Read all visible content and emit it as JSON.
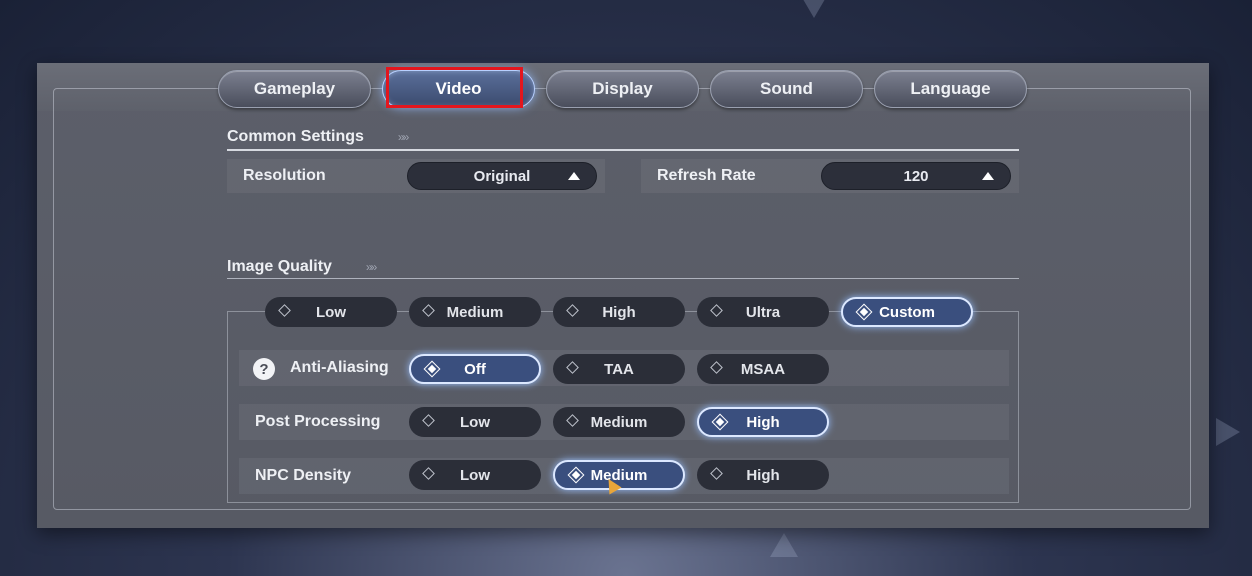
{
  "tabs": [
    {
      "label": "Gameplay",
      "active": false
    },
    {
      "label": "Video",
      "active": true
    },
    {
      "label": "Display",
      "active": false
    },
    {
      "label": "Sound",
      "active": false
    },
    {
      "label": "Language",
      "active": false
    }
  ],
  "common": {
    "title": "Common Settings",
    "chevrons": "»»",
    "resolution": {
      "label": "Resolution",
      "value": "Original"
    },
    "refresh_rate": {
      "label": "Refresh Rate",
      "value": "120"
    }
  },
  "image_quality": {
    "title": "Image Quality",
    "chevrons": "»»",
    "presets": [
      "Low",
      "Medium",
      "High",
      "Ultra",
      "Custom"
    ],
    "preset_selected": "Custom",
    "anti_aliasing": {
      "label": "Anti-Aliasing",
      "help_icon": "?",
      "options": [
        "Off",
        "TAA",
        "MSAA"
      ],
      "selected": "Off"
    },
    "post_processing": {
      "label": "Post Processing",
      "options": [
        "Low",
        "Medium",
        "High"
      ],
      "selected": "High"
    },
    "npc_density": {
      "label": "NPC Density",
      "options": [
        "Low",
        "Medium",
        "High"
      ],
      "selected": "Medium"
    }
  },
  "colors": {
    "accent_glow": "#b8d0ff",
    "highlight_box": "#e3161e"
  }
}
